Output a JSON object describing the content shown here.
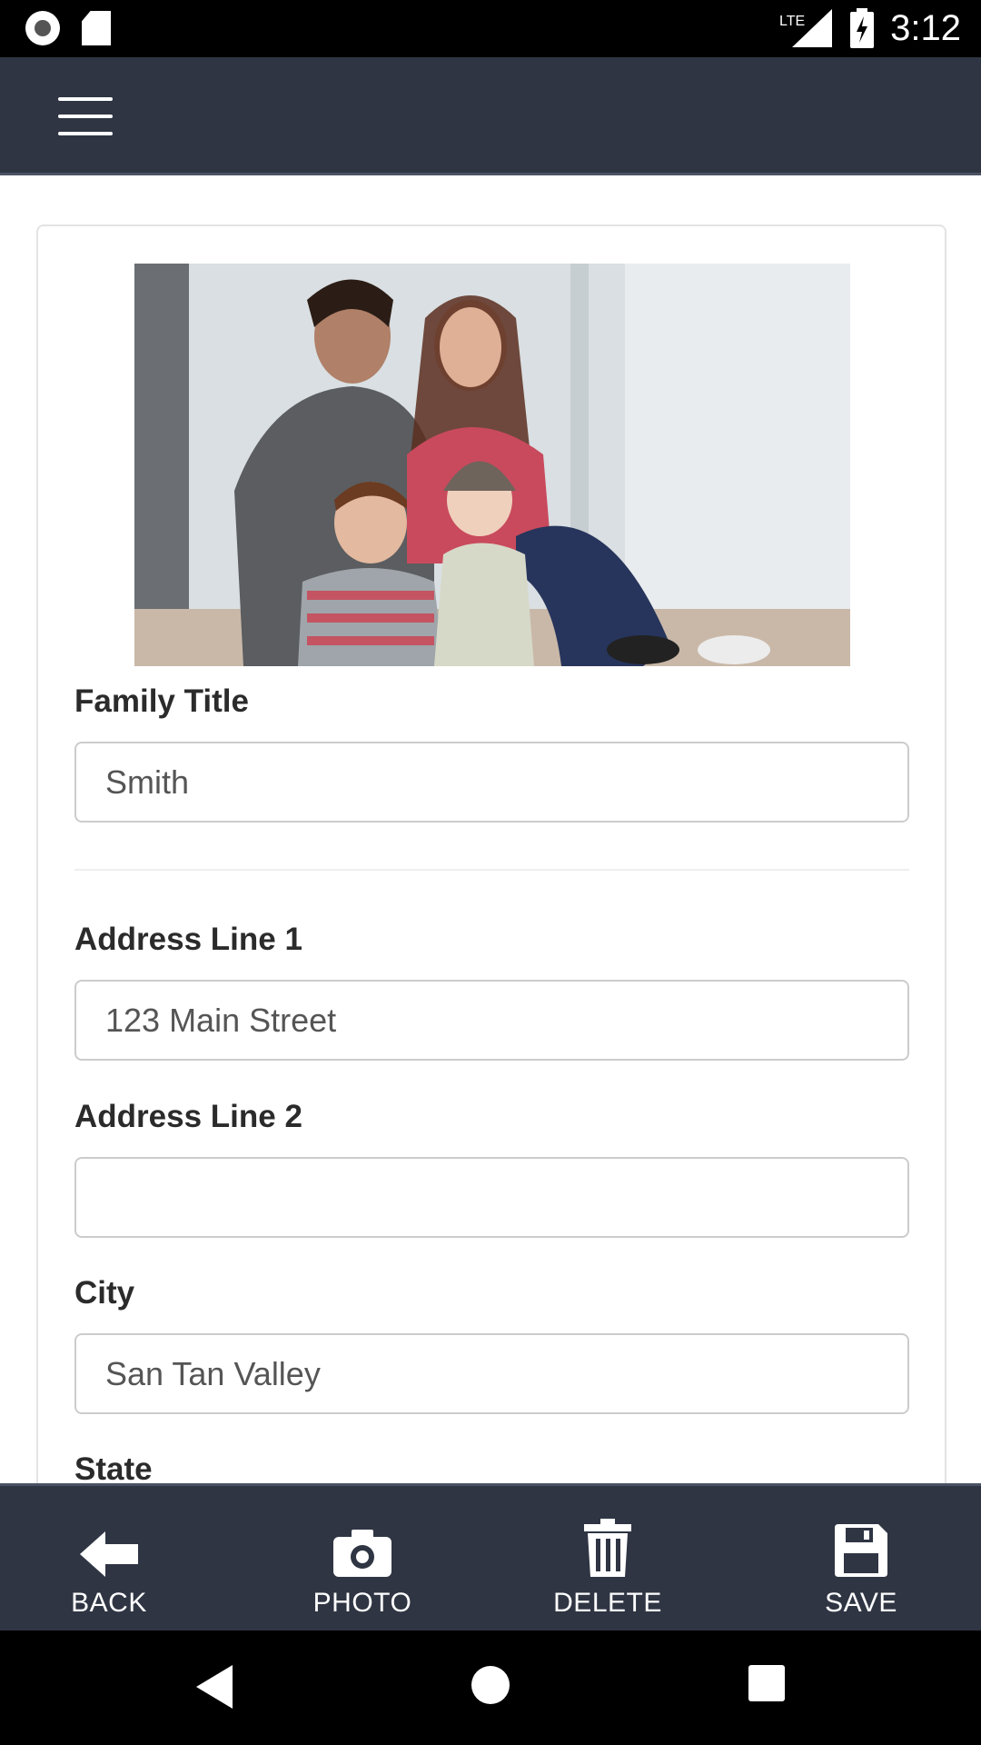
{
  "status_bar": {
    "time": "3:12",
    "network": "LTE",
    "icons": [
      "record-icon",
      "sd-card-icon",
      "signal-icon",
      "battery-charging-icon"
    ]
  },
  "app_bar": {
    "menu_icon": "hamburger-menu-icon"
  },
  "photo": {
    "description_icon": "family-photo"
  },
  "form": {
    "family_title": {
      "label": "Family Title",
      "value": "Smith"
    },
    "address_line_1": {
      "label": "Address Line 1",
      "value": "123 Main Street"
    },
    "address_line_2": {
      "label": "Address Line 2",
      "value": ""
    },
    "city": {
      "label": "City",
      "value": "San Tan Valley"
    },
    "state": {
      "label": "State"
    }
  },
  "toolbar": {
    "back_label": "BACK",
    "photo_label": "PHOTO",
    "delete_label": "DELETE",
    "save_label": "SAVE"
  },
  "nav_bar": {
    "icons": [
      "back-triangle-icon",
      "home-circle-icon",
      "recents-square-icon"
    ]
  }
}
